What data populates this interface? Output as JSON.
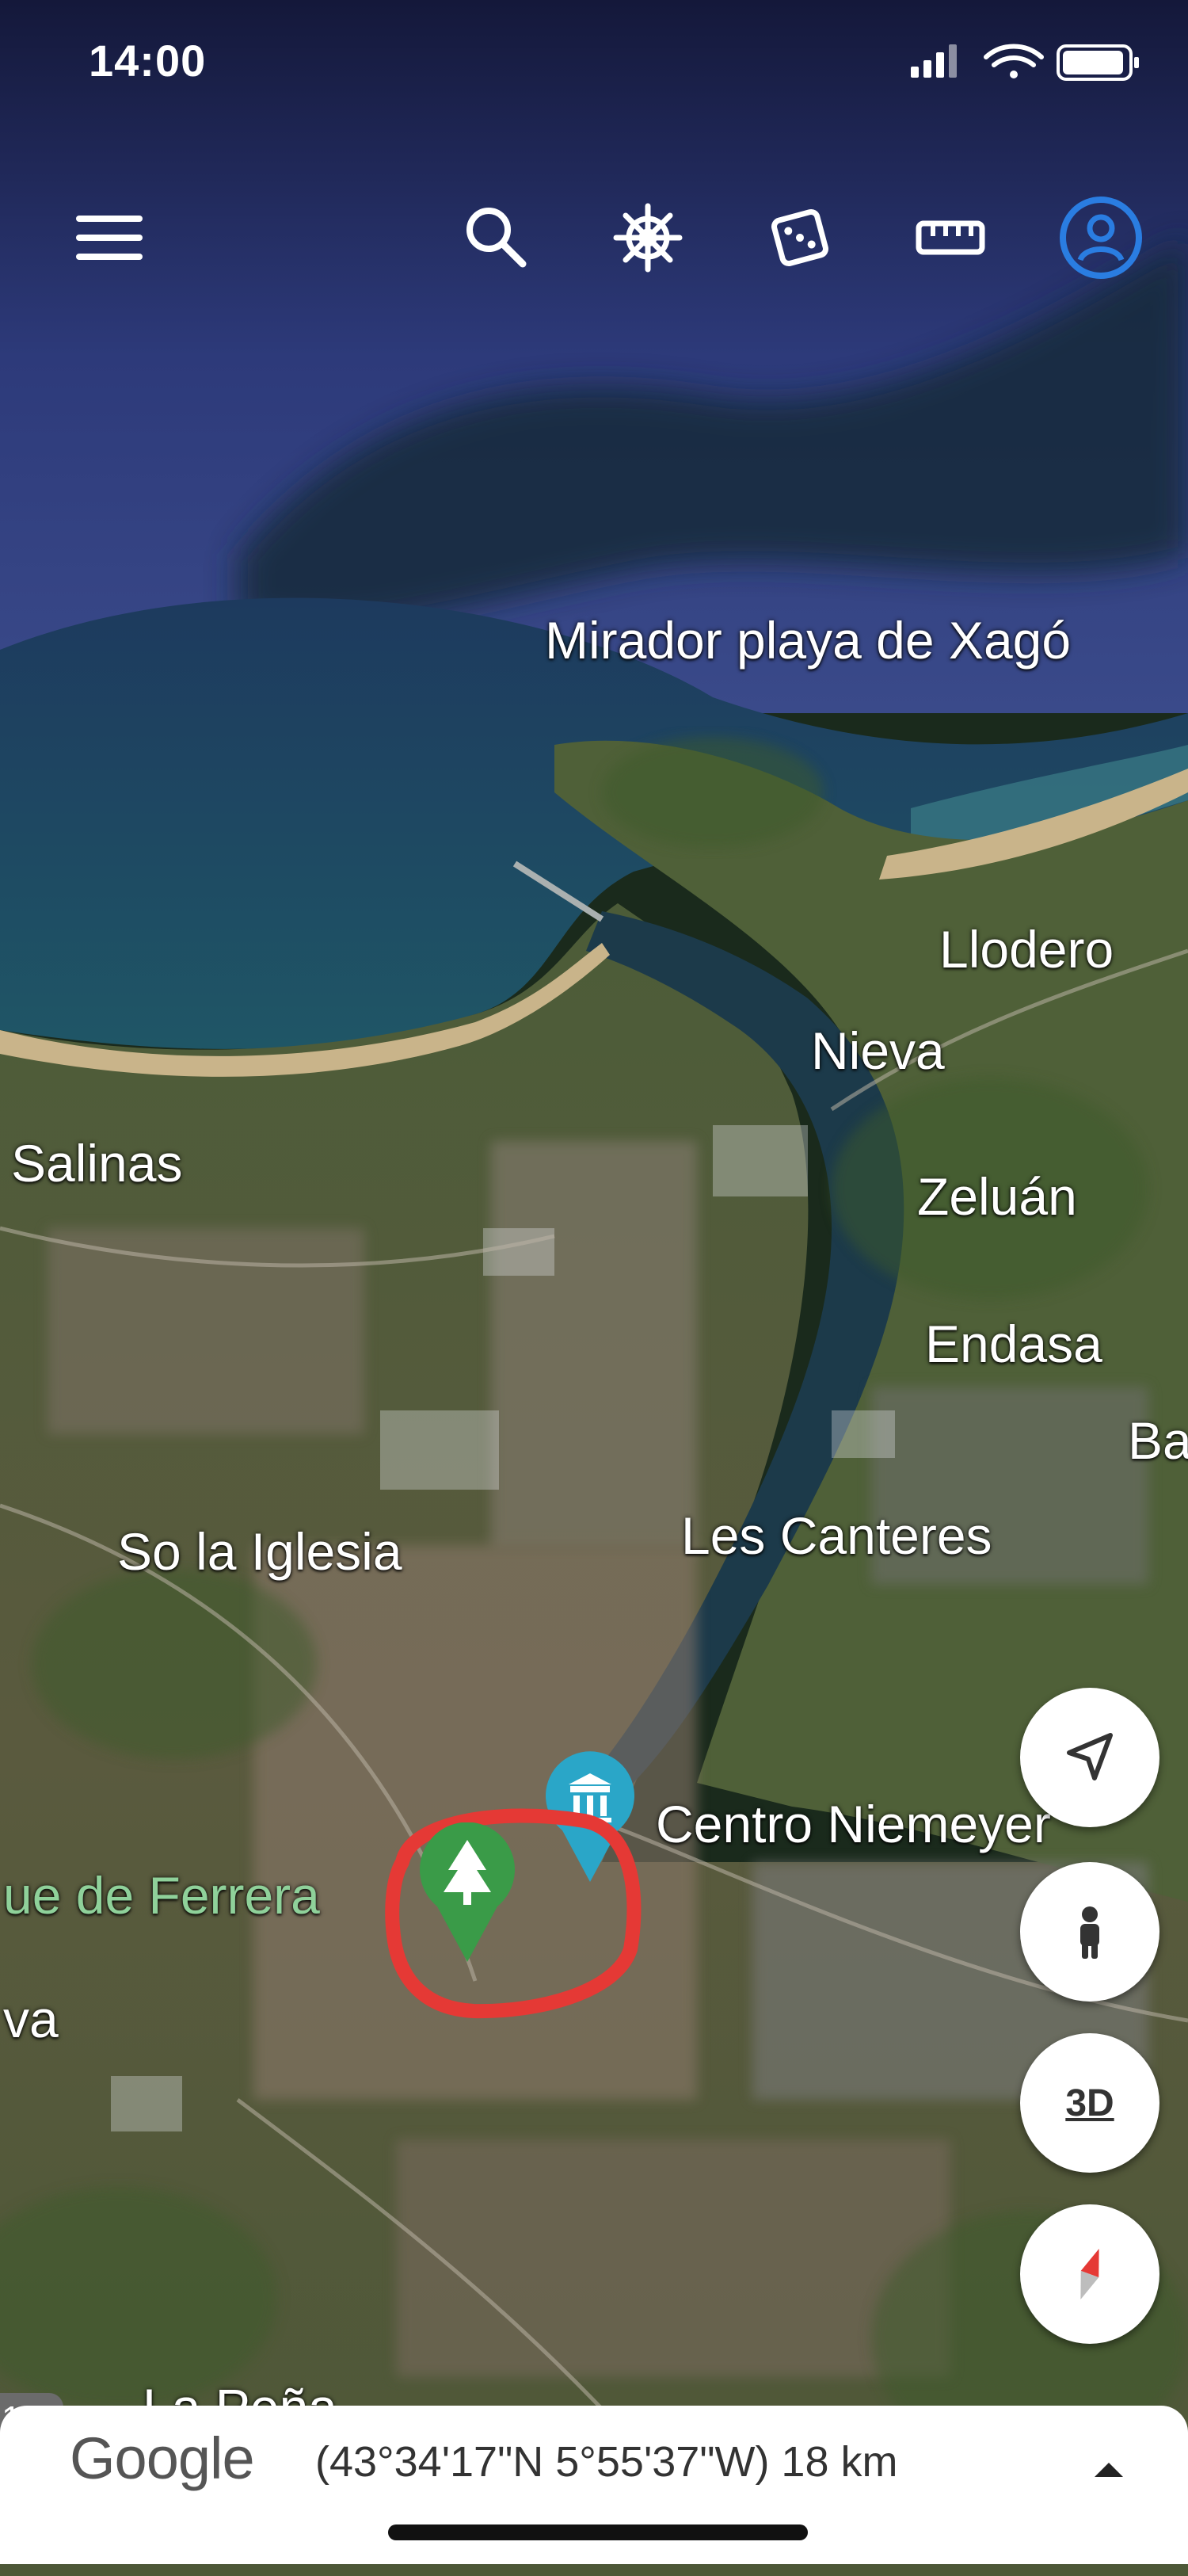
{
  "status_bar": {
    "time": "14:00"
  },
  "toolbar": {
    "icons": [
      "menu-icon",
      "search-icon",
      "ships-wheel-icon",
      "dice-icon",
      "ruler-icon",
      "account-icon"
    ],
    "accent": "#2a7de1"
  },
  "map_labels": {
    "mirador": "Mirador playa de Xagó",
    "llodero": "Llodero",
    "nieva": "Nieva",
    "salinas": "Salinas",
    "zeluan": "Zeluán",
    "endasa": "Endasa",
    "ba": "Ba",
    "so_la_iglesia": "So la Iglesia",
    "les_canteres": "Les Canteres",
    "centro_niemeyer": "Centro Niemeyer",
    "parque_ferrera": "ue de Ferrera",
    "va": "va",
    "la_pena": "La Peña"
  },
  "markers": {
    "park_marker_color": "#3a9b48",
    "museum_marker_color": "#2aa6c8",
    "highlight_circle_color": "#e53935"
  },
  "controls": {
    "three_d_label": "3D"
  },
  "bottom_bar": {
    "brand": "Google",
    "coords": "(43°34'17\"N 5°55'37\"W) 18 km"
  },
  "left_tab": {
    "label": "1"
  }
}
